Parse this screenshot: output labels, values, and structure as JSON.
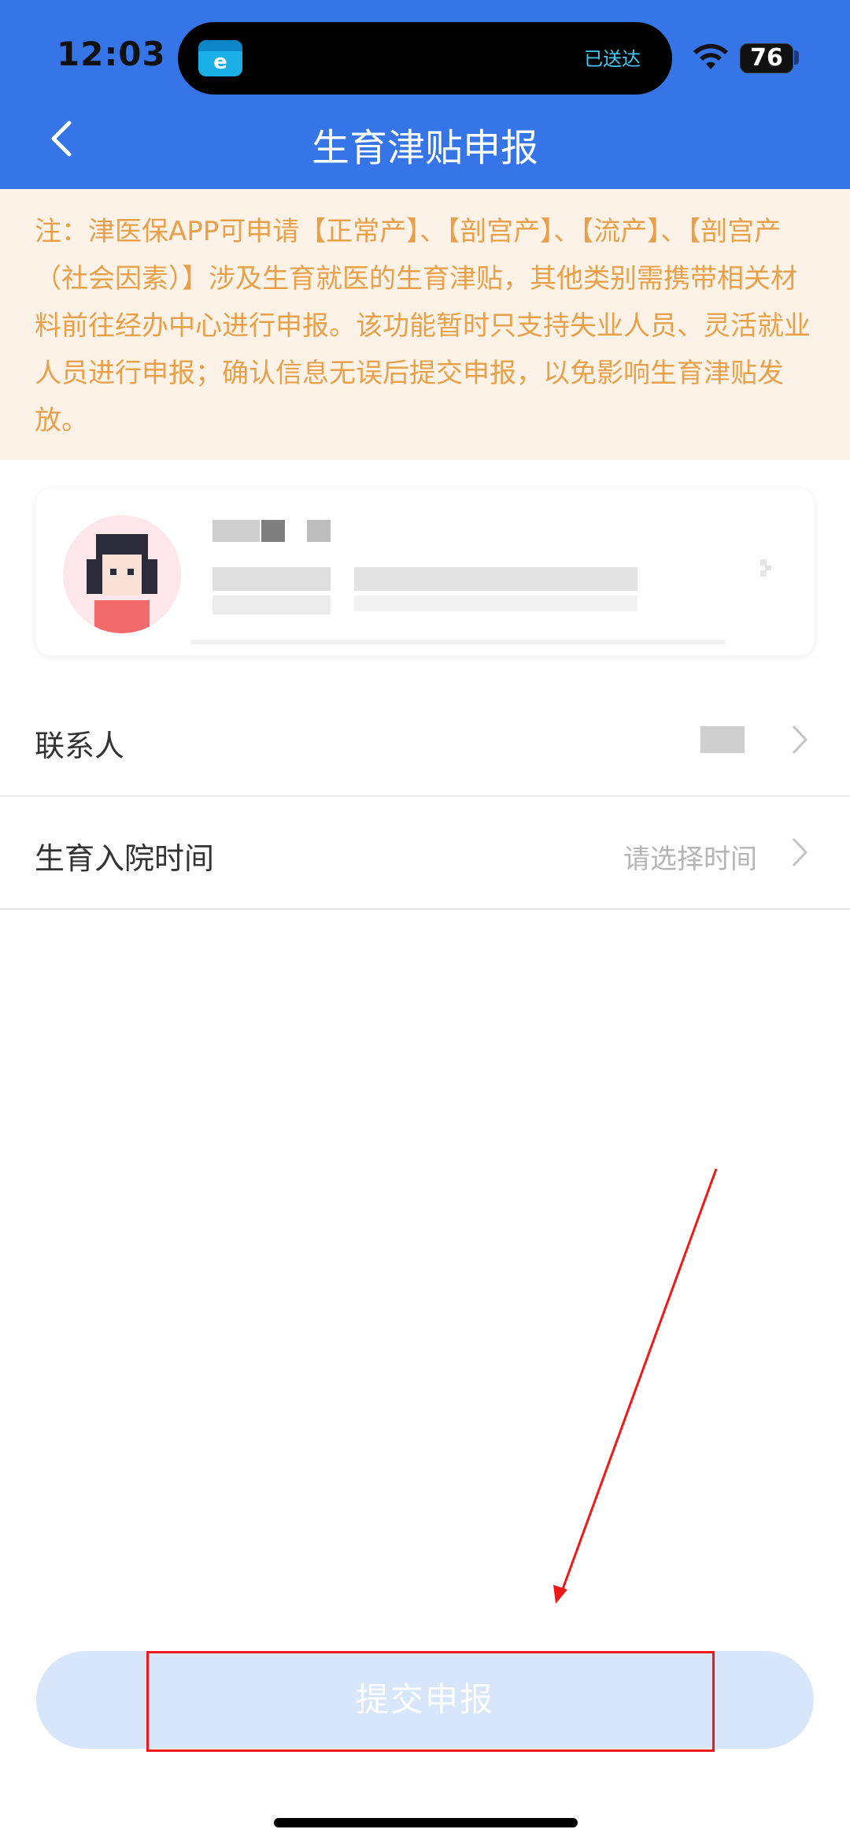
{
  "status_bar": {
    "time": "12:03",
    "live_activity_text": "已送达",
    "battery_level": "76"
  },
  "header": {
    "title": "生育津贴申报"
  },
  "notice": {
    "text": "注：津医保APP可申请【正常产】、【剖宫产】、【流产】、【剖宫产（社会因素）】涉及生育就医的生育津贴，其他类别需携带相关材料前往经办中心进行申报。该功能暂时只支持失业人员、灵活就业人员进行申报；确认信息无误后提交申报，以免影响生育津贴发放。"
  },
  "form": {
    "contact_label": "联系人",
    "admission_time_label": "生育入院时间",
    "admission_time_placeholder": "请选择时间"
  },
  "actions": {
    "submit_label": "提交申报"
  },
  "colors": {
    "header_bg": "#3575e8",
    "notice_bg": "#fdf2e7",
    "notice_text": "#e8a14a",
    "submit_bg": "#d8e6fc",
    "annotation_red": "#f01818"
  }
}
